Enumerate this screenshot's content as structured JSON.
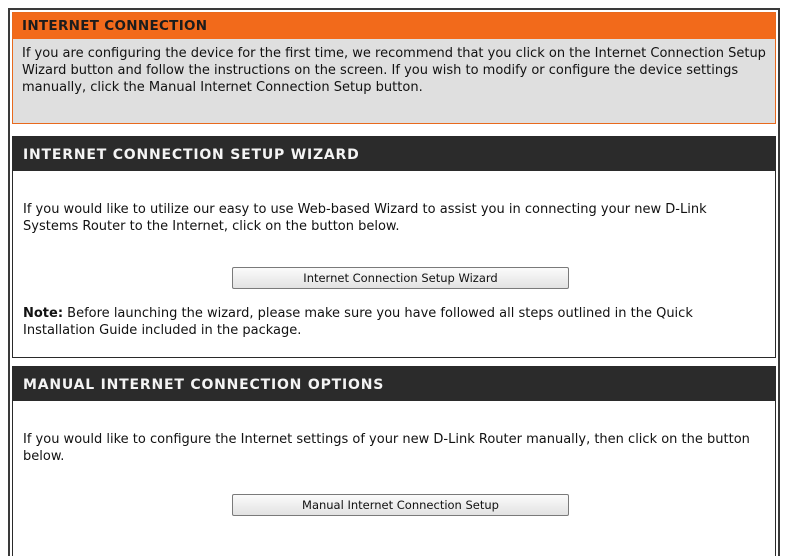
{
  "intro": {
    "title": "INTERNET CONNECTION",
    "text": "If you are configuring the device for the first time, we recommend that you click on the Internet Connection Setup Wizard button and follow the instructions on the screen. If you wish to modify or configure the device settings manually, click the Manual Internet Connection Setup button."
  },
  "wizard": {
    "title": "INTERNET CONNECTION SETUP WIZARD",
    "text": "If you would like to utilize our easy to use Web-based Wizard to assist you in connecting your new D-Link Systems Router to the Internet, click on the button below.",
    "button_label": "Internet Connection Setup Wizard",
    "note_label": "Note:",
    "note_text": " Before launching the wizard, please make sure you have followed all steps outlined in the Quick Installation Guide included in the package."
  },
  "manual": {
    "title": "MANUAL INTERNET CONNECTION OPTIONS",
    "text": "If you would like to configure the Internet settings of your new D-Link Router manually, then click on the button below.",
    "button_label": "Manual Internet Connection Setup"
  },
  "colors": {
    "accent_orange": "#f26a1b",
    "header_dark": "#2b2b2b",
    "intro_background": "#dfdfdf"
  }
}
